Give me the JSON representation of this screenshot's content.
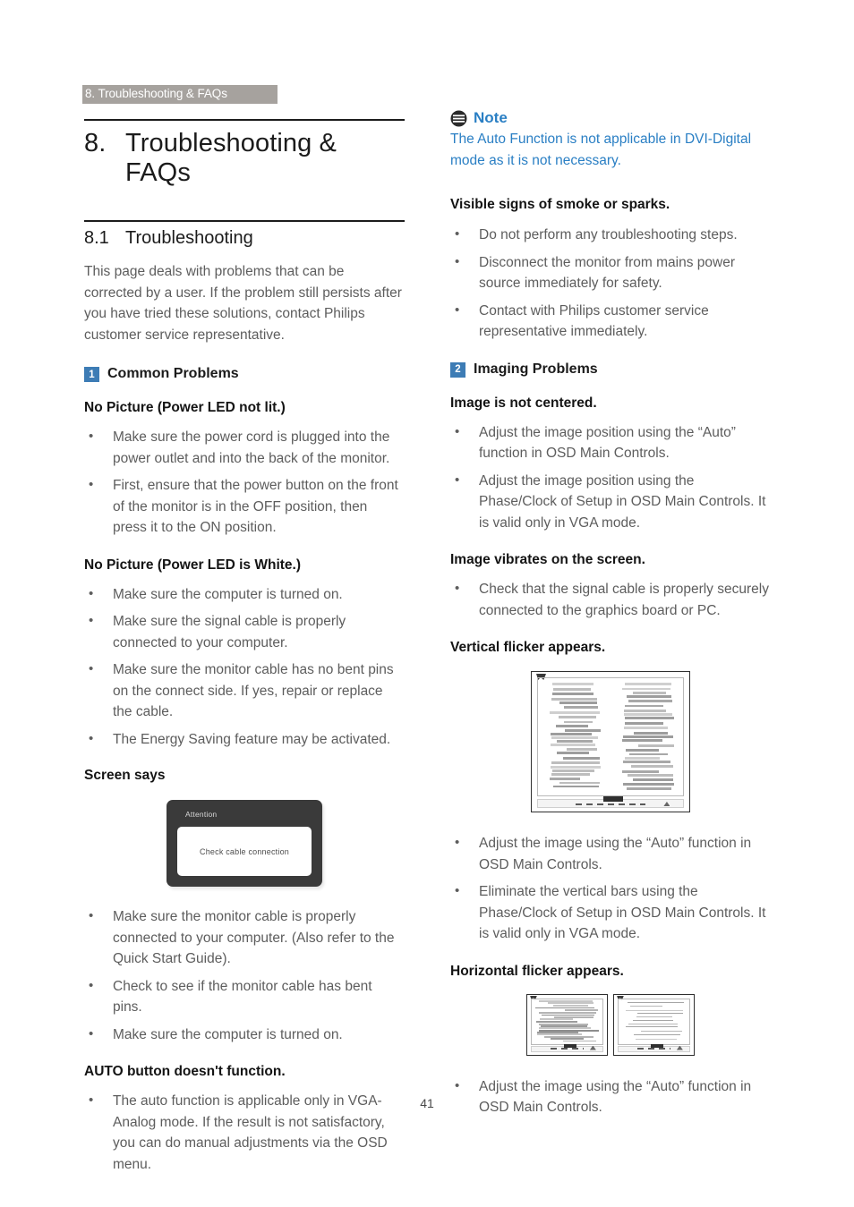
{
  "header": {
    "running_head": "8. Troubleshooting & FAQs"
  },
  "chapter": {
    "number": "8.",
    "title": "Troubleshooting & FAQs"
  },
  "section": {
    "number": "8.1",
    "title": "Troubleshooting",
    "intro": "This page deals with problems that can be corrected by a user. If the problem still persists after you have tried these solutions, contact Philips customer service representative."
  },
  "colors": {
    "badge_blue": "#3d7cb5",
    "note_blue": "#2a7fc4",
    "running_head_gray": "#a6a29e",
    "body_gray": "#5d5d5d",
    "heading_black": "#1b1b1b"
  },
  "left_column": {
    "group1": {
      "badge": "1",
      "title": "Common Problems"
    },
    "sub1": {
      "heading": "No Picture (Power LED not lit.)",
      "bullets": [
        "Make sure the power cord is plugged into the power outlet and into the back of the monitor.",
        "First, ensure that the power button on the front of the monitor is in the OFF position, then press it to the ON position."
      ]
    },
    "sub2": {
      "heading": "No Picture (Power LED is White.)",
      "bullets": [
        "Make sure the computer is turned on.",
        "Make sure the signal cable is properly connected to your computer.",
        "Make sure the monitor cable has no bent pins on the connect side. If yes, repair or replace the cable.",
        "The Energy Saving feature may be activated."
      ]
    },
    "sub3": {
      "heading": "Screen says",
      "dialog": {
        "title": "Attention",
        "message": "Check cable connection"
      },
      "bullets": [
        "Make sure the monitor cable is properly connected to your computer. (Also refer to the Quick Start Guide).",
        "Check to see if the monitor cable has bent pins.",
        "Make sure the computer is turned on."
      ]
    },
    "sub4": {
      "heading": "AUTO button doesn't function.",
      "bullets": [
        "The auto function is applicable only in VGA-Analog mode.  If the result is not satisfactory, you can do manual adjustments via the OSD menu."
      ]
    }
  },
  "right_column": {
    "note": {
      "icon": "note-icon",
      "title": "Note",
      "body": "The Auto Function is not applicable in DVI-Digital mode as it is not necessary."
    },
    "sub1": {
      "heading": "Visible signs of smoke or sparks.",
      "bullets": [
        "Do not perform any troubleshooting steps.",
        "Disconnect the monitor from mains power source immediately for safety.",
        "Contact with Philips customer service representative immediately."
      ]
    },
    "group2": {
      "badge": "2",
      "title": "Imaging Problems"
    },
    "sub2": {
      "heading": "Image is not centered.",
      "bullets": [
        "Adjust the image position using the “Auto” function in OSD Main Controls.",
        "Adjust the image position using the Phase/Clock of Setup in OSD Main Controls.  It is valid only in VGA mode."
      ]
    },
    "sub3": {
      "heading": "Image vibrates on the screen.",
      "bullets": [
        "Check that the signal cable is properly securely connected to the graphics board or PC."
      ]
    },
    "sub4": {
      "heading": "Vertical flicker appears.",
      "figure_alt": "vertical-flicker-test-pattern",
      "bullets": [
        "Adjust the image using the “Auto” function in OSD Main Controls.",
        "Eliminate the vertical bars using the Phase/Clock of Setup in OSD Main Controls. It is valid only in VGA mode."
      ]
    },
    "sub5": {
      "heading": "Horizontal flicker appears.",
      "figure_alt": "horizontal-flicker-test-pattern",
      "bullets": [
        "Adjust the image using the “Auto” function in OSD Main Controls."
      ]
    }
  },
  "footer": {
    "page_number": "41"
  }
}
